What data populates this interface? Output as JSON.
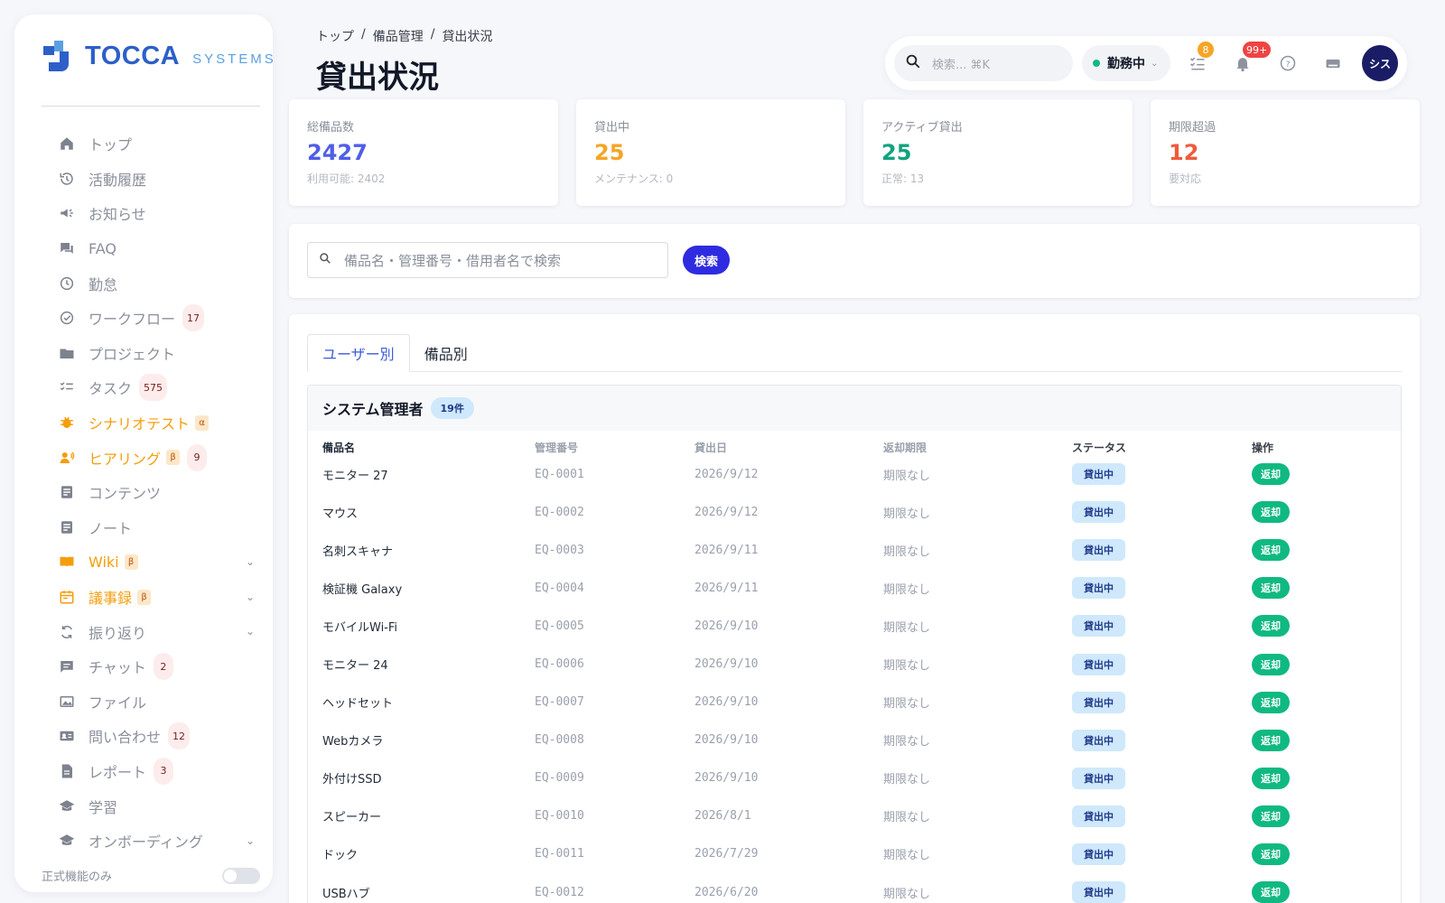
{
  "sidebar": {
    "logo_main": "TOCCA",
    "logo_sub": "SYSTEMS",
    "items": [
      {
        "label": "トップ",
        "icon": "home-icon"
      },
      {
        "label": "活動履歴",
        "icon": "history-icon"
      },
      {
        "label": "お知らせ",
        "icon": "megaphone-icon"
      },
      {
        "label": "FAQ",
        "icon": "forum-icon"
      },
      {
        "label": "勤怠",
        "icon": "clock-icon"
      },
      {
        "label": "ワークフロー",
        "icon": "check-circle-icon",
        "badge": "17"
      },
      {
        "label": "プロジェクト",
        "icon": "folder-icon"
      },
      {
        "label": "タスク",
        "icon": "checklist-icon",
        "badge": "575"
      },
      {
        "label": "シナリオテスト",
        "icon": "bug-icon",
        "greek": "α"
      },
      {
        "label": "ヒアリング",
        "icon": "interview-icon",
        "greek": "β",
        "badge": "9"
      },
      {
        "label": "コンテンツ",
        "icon": "article-icon"
      },
      {
        "label": "ノート",
        "icon": "note-icon"
      },
      {
        "label": "Wiki",
        "icon": "book-icon",
        "greek": "β"
      },
      {
        "label": "議事録",
        "icon": "calendar-icon",
        "greek": "β"
      },
      {
        "label": "振り返り",
        "icon": "refresh-icon"
      },
      {
        "label": "チャット",
        "icon": "chat-icon",
        "badge": "2"
      },
      {
        "label": "ファイル",
        "icon": "image-icon"
      },
      {
        "label": "問い合わせ",
        "icon": "contact-card-icon",
        "badge": "12"
      },
      {
        "label": "レポート",
        "icon": "document-icon",
        "badge": "3"
      },
      {
        "label": "学習",
        "icon": "school-icon"
      },
      {
        "label": "オンボーディング",
        "icon": "school-icon"
      }
    ],
    "footer_label": "正式機能のみ"
  },
  "header": {
    "breadcrumb": [
      "トップ",
      "備品管理",
      "貸出状況"
    ],
    "title": "貸出状況",
    "search_placeholder": "検索... ⌘K",
    "status_label": "勤務中",
    "tasks_badge": "8",
    "notifications_badge": "99+",
    "avatar_label": "シス"
  },
  "stats": [
    {
      "label": "総備品数",
      "value": "2427",
      "sub": "利用可能: 2402",
      "color": "#4f5ee8"
    },
    {
      "label": "貸出中",
      "value": "25",
      "sub": "メンテナンス: 0",
      "color": "#f5a524"
    },
    {
      "label": "アクティブ貸出",
      "value": "25",
      "sub": "正常: 13",
      "color": "#10a37f"
    },
    {
      "label": "期限超過",
      "value": "12",
      "sub": "要対応",
      "color": "#ef5a3c"
    }
  ],
  "search": {
    "placeholder": "備品名・管理番号・借用者名で検索",
    "button": "検索"
  },
  "tabs": [
    "ユーザー別",
    "備品別"
  ],
  "group": {
    "title": "システム管理者",
    "count": "19件",
    "columns": [
      "備品名",
      "管理番号",
      "貸出日",
      "返却期限",
      "ステータス",
      "操作"
    ],
    "rows": [
      {
        "name": "モニター 27",
        "code": "EQ-0001",
        "date": "2026/9/12",
        "due": "期限なし",
        "status": "貸出中",
        "action": "返却"
      },
      {
        "name": "マウス",
        "code": "EQ-0002",
        "date": "2026/9/12",
        "due": "期限なし",
        "status": "貸出中",
        "action": "返却"
      },
      {
        "name": "名刺スキャナ",
        "code": "EQ-0003",
        "date": "2026/9/11",
        "due": "期限なし",
        "status": "貸出中",
        "action": "返却"
      },
      {
        "name": "検証機 Galaxy",
        "code": "EQ-0004",
        "date": "2026/9/11",
        "due": "期限なし",
        "status": "貸出中",
        "action": "返却"
      },
      {
        "name": "モバイルWi-Fi",
        "code": "EQ-0005",
        "date": "2026/9/10",
        "due": "期限なし",
        "status": "貸出中",
        "action": "返却"
      },
      {
        "name": "モニター 24",
        "code": "EQ-0006",
        "date": "2026/9/10",
        "due": "期限なし",
        "status": "貸出中",
        "action": "返却"
      },
      {
        "name": "ヘッドセット",
        "code": "EQ-0007",
        "date": "2026/9/10",
        "due": "期限なし",
        "status": "貸出中",
        "action": "返却"
      },
      {
        "name": "Webカメラ",
        "code": "EQ-0008",
        "date": "2026/9/10",
        "due": "期限なし",
        "status": "貸出中",
        "action": "返却"
      },
      {
        "name": "外付けSSD",
        "code": "EQ-0009",
        "date": "2026/9/10",
        "due": "期限なし",
        "status": "貸出中",
        "action": "返却"
      },
      {
        "name": "スピーカー",
        "code": "EQ-0010",
        "date": "2026/8/1",
        "due": "期限なし",
        "status": "貸出中",
        "action": "返却"
      },
      {
        "name": "ドック",
        "code": "EQ-0011",
        "date": "2026/7/29",
        "due": "期限なし",
        "status": "貸出中",
        "action": "返却"
      },
      {
        "name": "USBハブ",
        "code": "EQ-0012",
        "date": "2026/6/20",
        "due": "期限なし",
        "status": "貸出中",
        "action": "返却"
      }
    ]
  }
}
